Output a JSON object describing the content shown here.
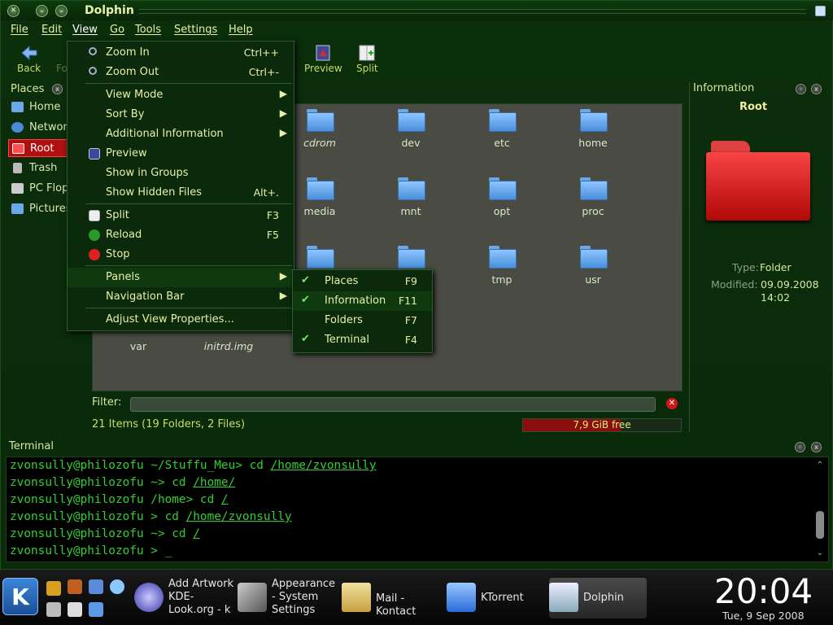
{
  "window": {
    "title": "Dolphin"
  },
  "menubar": {
    "file": "File",
    "edit": "Edit",
    "view": "View",
    "go": "Go",
    "tools": "Tools",
    "settings": "Settings",
    "help": "Help"
  },
  "toolbar": {
    "back": "Back",
    "forward": "Fo",
    "preview": "Preview",
    "split": "Split"
  },
  "places": {
    "title": "Places",
    "items": [
      {
        "label": "Home",
        "icon": "home-icon"
      },
      {
        "label": "Network",
        "icon": "network-icon"
      },
      {
        "label": "Root",
        "icon": "root-folder-icon",
        "selected": true
      },
      {
        "label": "Trash",
        "icon": "trash-icon"
      },
      {
        "label": "PC Flop",
        "icon": "floppy-icon"
      },
      {
        "label": "Pictures",
        "icon": "pictures-icon"
      }
    ]
  },
  "files": [
    {
      "name": "cdrom",
      "italic": true
    },
    {
      "name": "dev"
    },
    {
      "name": "etc"
    },
    {
      "name": "home"
    },
    {
      "name": "media"
    },
    {
      "name": "mnt"
    },
    {
      "name": "opt"
    },
    {
      "name": "proc"
    },
    {
      "name": "tmp"
    },
    {
      "name": "usr"
    },
    {
      "name": "var"
    },
    {
      "name": "initrd.img",
      "italic": true
    }
  ],
  "filter": {
    "label": "Filter:",
    "value": ""
  },
  "status": {
    "items": "21 Items (19 Folders, 2 Files)",
    "free": "7,9 GiB free",
    "used_fraction": 0.62
  },
  "information": {
    "title": "Information",
    "name": "Root",
    "type_label": "Type:",
    "type_value": "Folder",
    "modified_label": "Modified:",
    "modified_date": "09.09.2008",
    "modified_time": "14:02"
  },
  "view_menu": {
    "zoom_in": "Zoom In",
    "zoom_in_sc": "Ctrl++",
    "zoom_out": "Zoom Out",
    "zoom_out_sc": "Ctrl+-",
    "view_mode": "View Mode",
    "sort_by": "Sort By",
    "additional_info": "Additional Information",
    "preview": "Preview",
    "show_groups": "Show in Groups",
    "show_hidden": "Show Hidden Files",
    "show_hidden_sc": "Alt+.",
    "split": "Split",
    "split_sc": "F3",
    "reload": "Reload",
    "reload_sc": "F5",
    "stop": "Stop",
    "panels": "Panels",
    "nav_bar": "Navigation Bar",
    "adjust": "Adjust View Properties..."
  },
  "panels_submenu": [
    {
      "label": "Places",
      "shortcut": "F9",
      "checked": true
    },
    {
      "label": "Information",
      "shortcut": "F11",
      "checked": true
    },
    {
      "label": "Folders",
      "shortcut": "F7",
      "checked": false
    },
    {
      "label": "Terminal",
      "shortcut": "F4",
      "checked": true
    }
  ],
  "terminal": {
    "title": "Terminal",
    "lines": [
      {
        "prompt": "zvonsully@philozofu ~/Stuffu_Meu> cd ",
        "arg": "/home/zvonsully"
      },
      {
        "prompt": "zvonsully@philozofu ~> cd ",
        "arg": "/home/"
      },
      {
        "prompt": "zvonsully@philozofu /home> cd ",
        "arg": "/"
      },
      {
        "prompt": "zvonsully@philozofu > cd ",
        "arg": "/home/zvonsully"
      },
      {
        "prompt": "zvonsully@philozofu ~> cd ",
        "arg": "/"
      },
      {
        "prompt": "zvonsully@philozofu > ",
        "arg": "_"
      }
    ]
  },
  "taskbar": {
    "tasks": [
      {
        "label": "Add Artwork\nKDE-\nLook.org - k",
        "icon": "globe-icon"
      },
      {
        "label": "Appearance\n- System\nSettings",
        "icon": "tools-icon"
      },
      {
        "label": "Mail -\nKontact",
        "icon": "mail-icon"
      },
      {
        "label": "KTorrent",
        "icon": "download-icon"
      },
      {
        "label": "Dolphin",
        "icon": "file-manager-icon",
        "active": true
      }
    ],
    "clock": "20:04",
    "date": "Tue, 9 Sep 2008"
  },
  "colors": {
    "accent": "#e8f0a8",
    "selected": "#b01010",
    "terminal_text": "#30d030"
  }
}
